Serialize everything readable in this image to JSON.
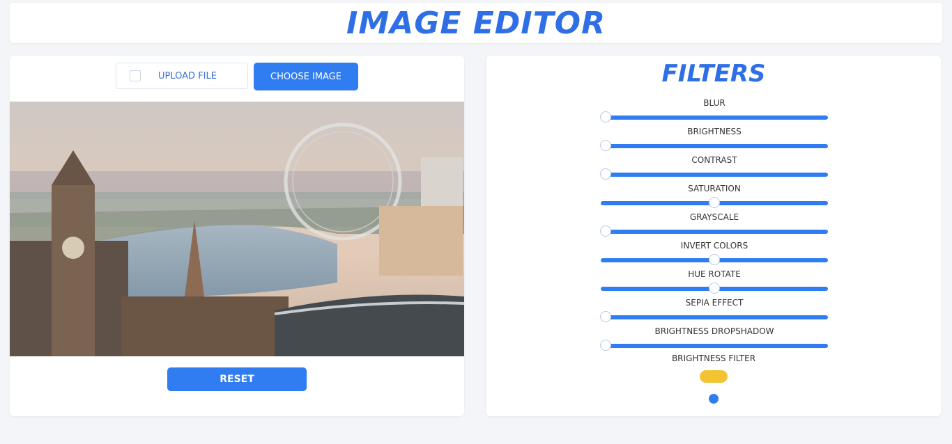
{
  "app": {
    "title": "IMAGE EDITOR"
  },
  "toolbar": {
    "file_input_label": "UPLOAD FILE",
    "choose_label": "CHOOSE IMAGE"
  },
  "editor": {
    "reset_label": "RESET"
  },
  "filters": {
    "title": "FILTERS",
    "items": [
      {
        "label": "BLUR",
        "value": 0.02
      },
      {
        "label": "BRIGHTNESS",
        "value": 0.02
      },
      {
        "label": "CONTRAST",
        "value": 0.02
      },
      {
        "label": "SATURATION",
        "value": 0.5
      },
      {
        "label": "GRAYSCALE",
        "value": 0.02
      },
      {
        "label": "INVERT COLORS",
        "value": 0.5
      },
      {
        "label": "HUE ROTATE",
        "value": 0.5
      },
      {
        "label": "SEPIA EFFECT",
        "value": 0.02
      },
      {
        "label": "BRIGHTNESS DROPSHADOW",
        "value": 0.02
      }
    ],
    "checkbox_label": "BRIGHTNESS FILTER"
  },
  "colors": {
    "accent": "#2f7df0",
    "title": "#2f6fe6",
    "toggle": "#f2c431"
  }
}
